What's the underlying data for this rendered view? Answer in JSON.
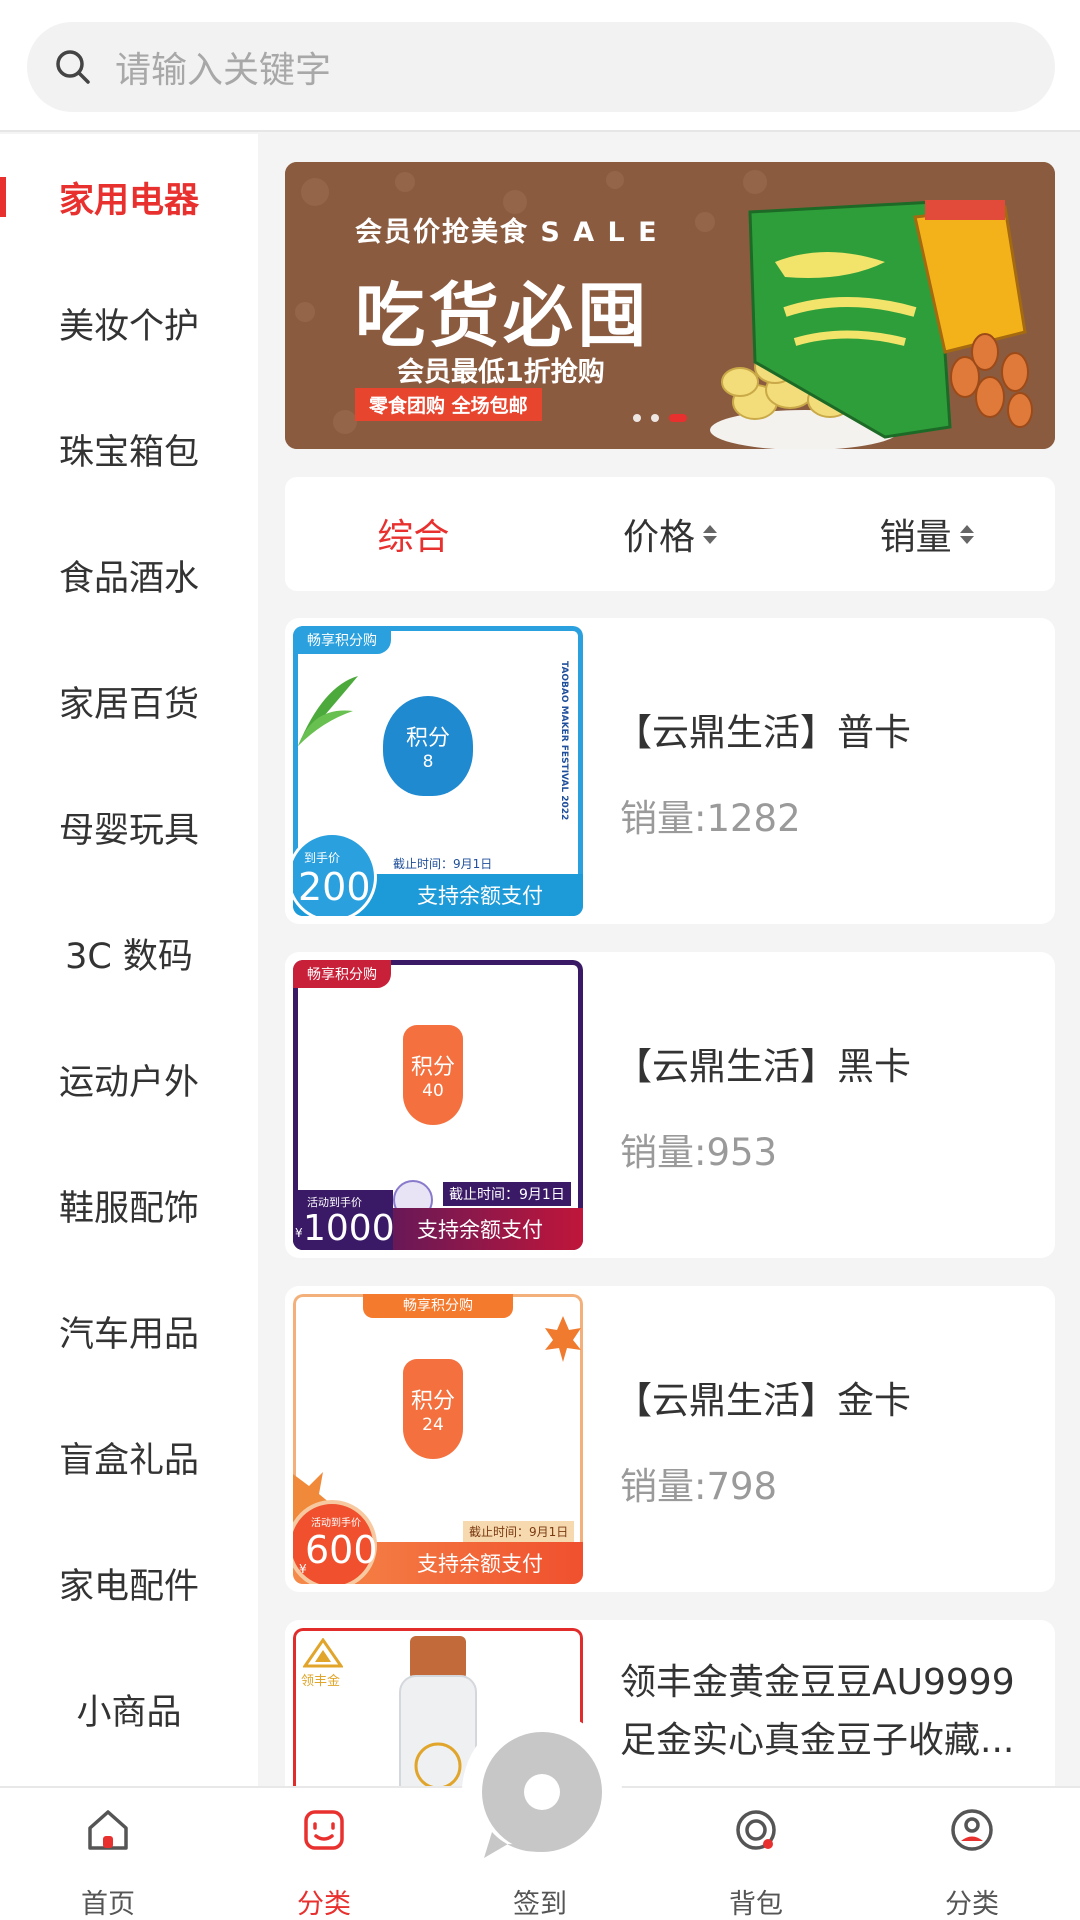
{
  "search": {
    "placeholder": "请输入关键字"
  },
  "sidebar": {
    "items": [
      {
        "label": "家用电器",
        "active": true
      },
      {
        "label": "美妆个护"
      },
      {
        "label": "珠宝箱包"
      },
      {
        "label": "食品酒水"
      },
      {
        "label": "家居百货"
      },
      {
        "label": "母婴玩具"
      },
      {
        "label": "3C 数码"
      },
      {
        "label": "运动户外"
      },
      {
        "label": "鞋服配饰"
      },
      {
        "label": "汽车用品"
      },
      {
        "label": "盲盒礼品"
      },
      {
        "label": "家电配件"
      },
      {
        "label": "小商品"
      }
    ]
  },
  "banner": {
    "line1": "会员价抢美食 S A L E",
    "line2": "吃货必囤",
    "line3": "会员最低1折抢购",
    "tag": "零食团购 全场包邮"
  },
  "sort": {
    "comprehensive": "综合",
    "price": "价格",
    "sales": "销量"
  },
  "products": [
    {
      "name": "【云鼎生活】普卡",
      "sales": "销量:1282",
      "tag": "畅享积分购",
      "badge_title": "积分",
      "badge_num": "8",
      "price_label": "到手价",
      "price": "200",
      "deadline": "截止时间：9月1日",
      "pay": "支持余额支付",
      "side_text": "TAOBAO MAKER FESTIVAL 2022",
      "accent": "#2aa0de"
    },
    {
      "name": "【云鼎生活】黑卡",
      "sales": "销量:953",
      "tag": "畅享积分购",
      "badge_title": "积分",
      "badge_num": "40",
      "price_label": "活动到手价",
      "price": "1000",
      "currency": "¥",
      "deadline": "截止时间：9月1日",
      "pay": "支持余额支付",
      "accent": "#3a1a66"
    },
    {
      "name": "【云鼎生活】金卡",
      "sales": "销量:798",
      "tag": "畅享积分购",
      "badge_title": "积分",
      "badge_num": "24",
      "price_label": "活动到手价",
      "price": "600",
      "currency": "¥",
      "deadline": "截止时间：9月1日",
      "pay": "支持余额支付",
      "accent": "#f07a3a"
    },
    {
      "name_line1": "领丰金黄金豆豆AU9999",
      "name_line2": "足金实心真金豆子收藏...",
      "brand": "领丰金"
    }
  ],
  "tabbar": [
    {
      "label": "首页",
      "icon": "home-icon"
    },
    {
      "label": "分类",
      "icon": "category-icon",
      "active": true
    },
    {
      "label": "签到",
      "icon": "checkin-icon"
    },
    {
      "label": "背包",
      "icon": "backpack-icon"
    },
    {
      "label": "分类",
      "icon": "profile-icon"
    }
  ],
  "colors": {
    "accent": "#e8302e",
    "background": "#f4f4f4"
  }
}
